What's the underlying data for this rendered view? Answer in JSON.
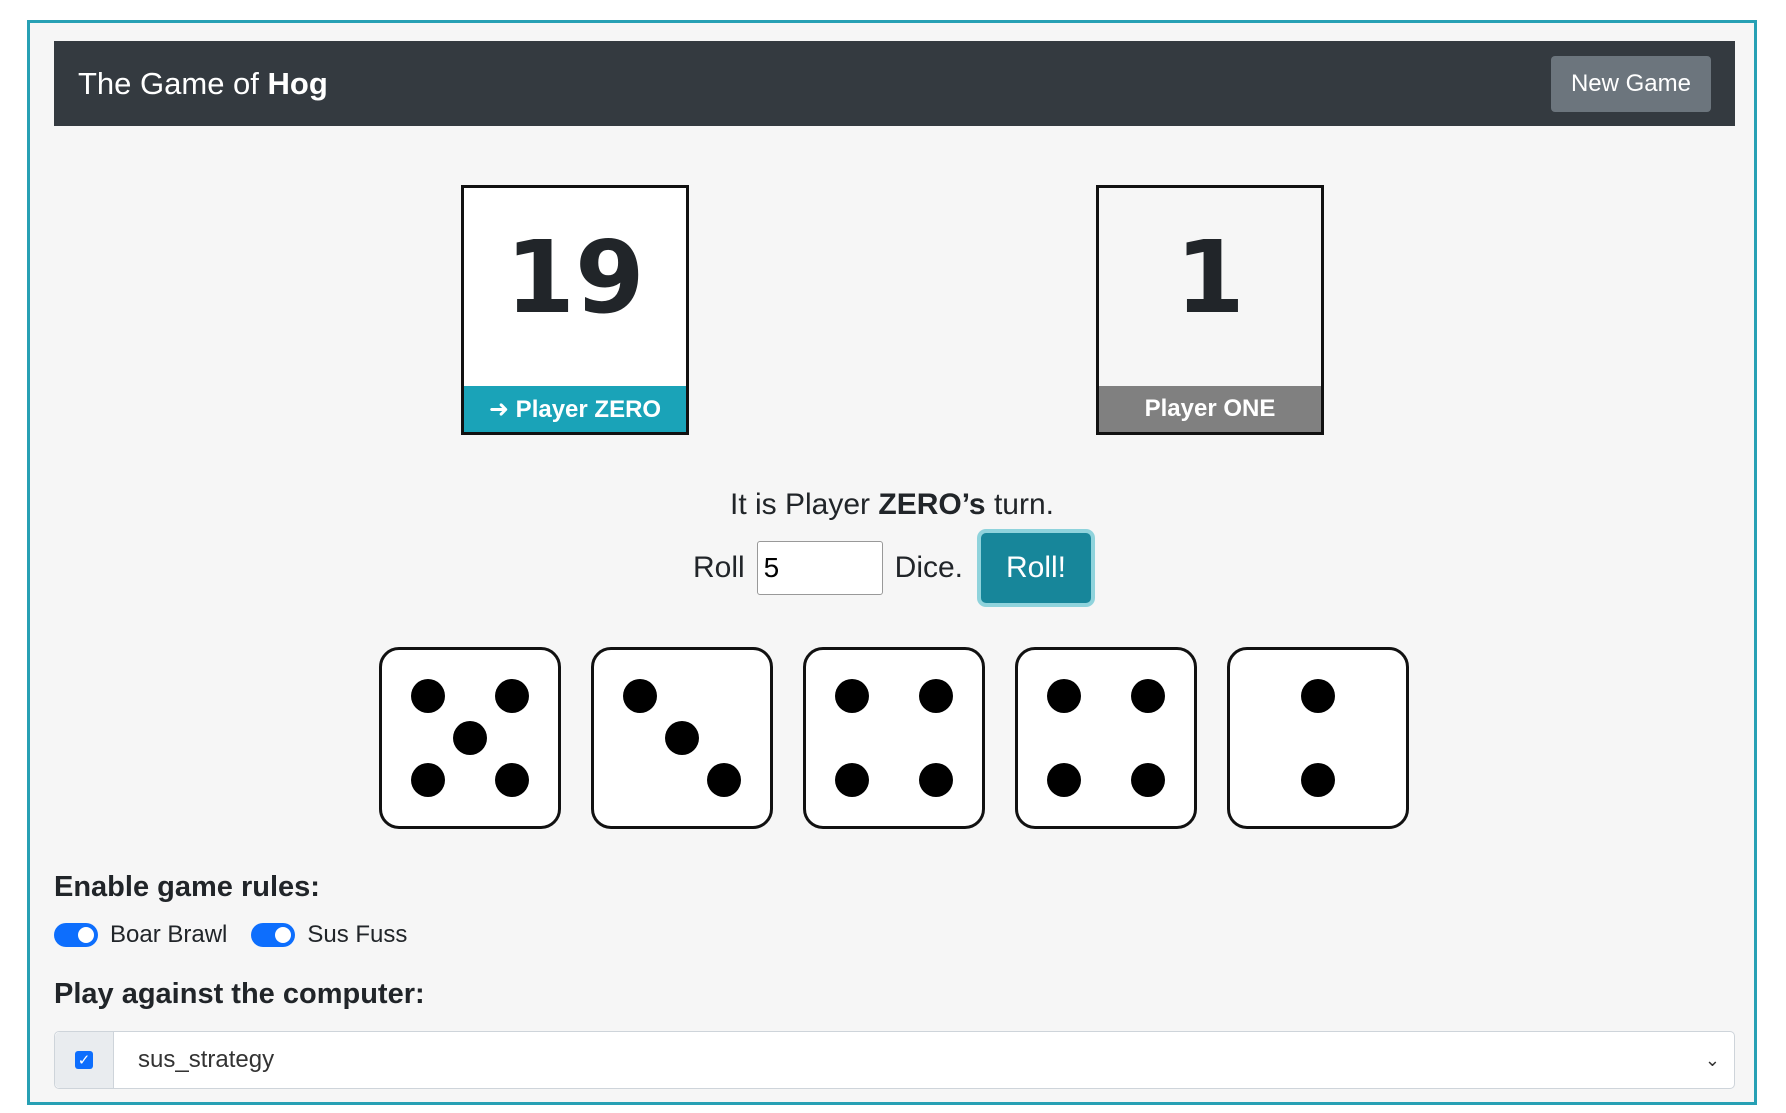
{
  "navbar": {
    "title_prefix": "The Game of ",
    "title_bold": "Hog",
    "new_game_label": "New Game"
  },
  "players": [
    {
      "score": "19",
      "label": "➜ Player ZERO",
      "active": true
    },
    {
      "score": "1",
      "label": "Player ONE",
      "active": false
    }
  ],
  "turn": {
    "prefix": "It is Player ",
    "player": "ZERO’s",
    "suffix": " turn."
  },
  "roll": {
    "prefix": "Roll",
    "value": "5",
    "suffix": "Dice.",
    "button_label": "Roll!"
  },
  "dice": [
    5,
    3,
    4,
    4,
    2
  ],
  "rules": {
    "title": "Enable game rules:",
    "toggles": [
      {
        "label": "Boar Brawl",
        "enabled": true
      },
      {
        "label": "Sus Fuss",
        "enabled": true
      }
    ]
  },
  "computer": {
    "title": "Play against the computer:",
    "enabled": true,
    "strategy": "sus_strategy"
  },
  "colors": {
    "accent": "#1aa3b8",
    "navbar": "#343a40",
    "switch_on": "#0d6efd"
  }
}
